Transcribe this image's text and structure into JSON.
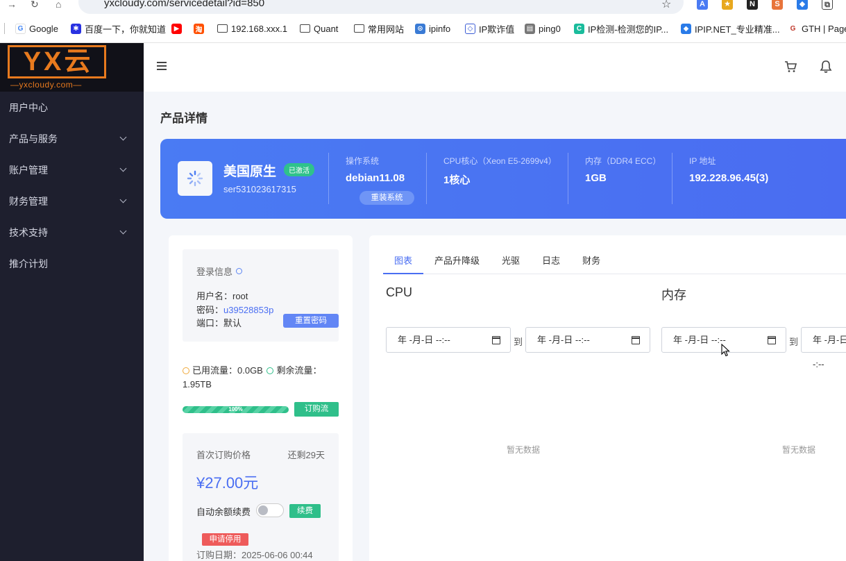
{
  "browser": {
    "url": "yxcloudy.com/servicedetail?id=850",
    "bookmarks": [
      {
        "label": "Google"
      },
      {
        "label": "百度一下，你就知道"
      },
      {
        "label": ""
      },
      {
        "label": ""
      },
      {
        "label": "192.168.xxx.1"
      },
      {
        "label": "Quant"
      },
      {
        "label": "常用网站"
      },
      {
        "label": "ipinfo"
      },
      {
        "label": "IP欺诈值"
      },
      {
        "label": "ping0"
      },
      {
        "label": "IP检测-检测您的IP..."
      },
      {
        "label": "IPIP.NET_专业精准..."
      },
      {
        "label": "GTH | Page"
      }
    ]
  },
  "logo": {
    "letters": [
      "Y",
      "X",
      "云"
    ],
    "sub": "—yxcloudy.com—"
  },
  "sidebar": {
    "items": [
      {
        "label": "用户中心"
      },
      {
        "label": "产品与服务"
      },
      {
        "label": "账户管理"
      },
      {
        "label": "财务管理"
      },
      {
        "label": "技术支持"
      },
      {
        "label": "推介计划"
      }
    ]
  },
  "page": {
    "title": "产品详情"
  },
  "product": {
    "name": "美国原生",
    "status": "已激活",
    "id": "ser531023617315",
    "os_label": "操作系统",
    "os_value": "debian11.08",
    "reinstall": "重装系统",
    "cpu_label": "CPU核心（Xeon E5-2699v4）",
    "cpu_value": "1核心",
    "mem_label": "内存（DDR4 ECC）",
    "mem_value": "1GB",
    "ip_label": "IP 地址",
    "ip_value": "192.228.96.45(3)"
  },
  "login": {
    "title": "登录信息",
    "username": "用户名：root",
    "password_label": "密码：",
    "password_value": "u39528853p",
    "port": "端口：默认",
    "reset": "重置密码"
  },
  "traffic": {
    "used": "已用流量：0.0GB",
    "remaining": "剩余流量：1.95TB",
    "progress_percent": 100,
    "progress_label": "100%",
    "buy": "订购流"
  },
  "billing": {
    "first_price_label": "首次订购价格",
    "days_left": "还剩29天",
    "price": "¥27.00元",
    "auto_renew_label": "自动余额续费",
    "auto_renew_on": false,
    "renew": "续费",
    "suspend": "申请停用",
    "order_date": "订购日期：2025-06-06 00:44"
  },
  "tabs": [
    {
      "label": "图表"
    },
    {
      "label": "产品升降级"
    },
    {
      "label": "光驱"
    },
    {
      "label": "日志"
    },
    {
      "label": "财务"
    }
  ],
  "charts": {
    "cpu_title": "CPU",
    "mem_title": "内存",
    "date_placeholder": "年 -月-日 --:--",
    "to": "到",
    "no_data": "暂无数据"
  },
  "colors": {
    "primary": "#4a6ef2",
    "success": "#2fbf8a",
    "danger": "#ee5b5b",
    "brand": "#e87a1e",
    "sidebar": "#1e1f2e"
  }
}
